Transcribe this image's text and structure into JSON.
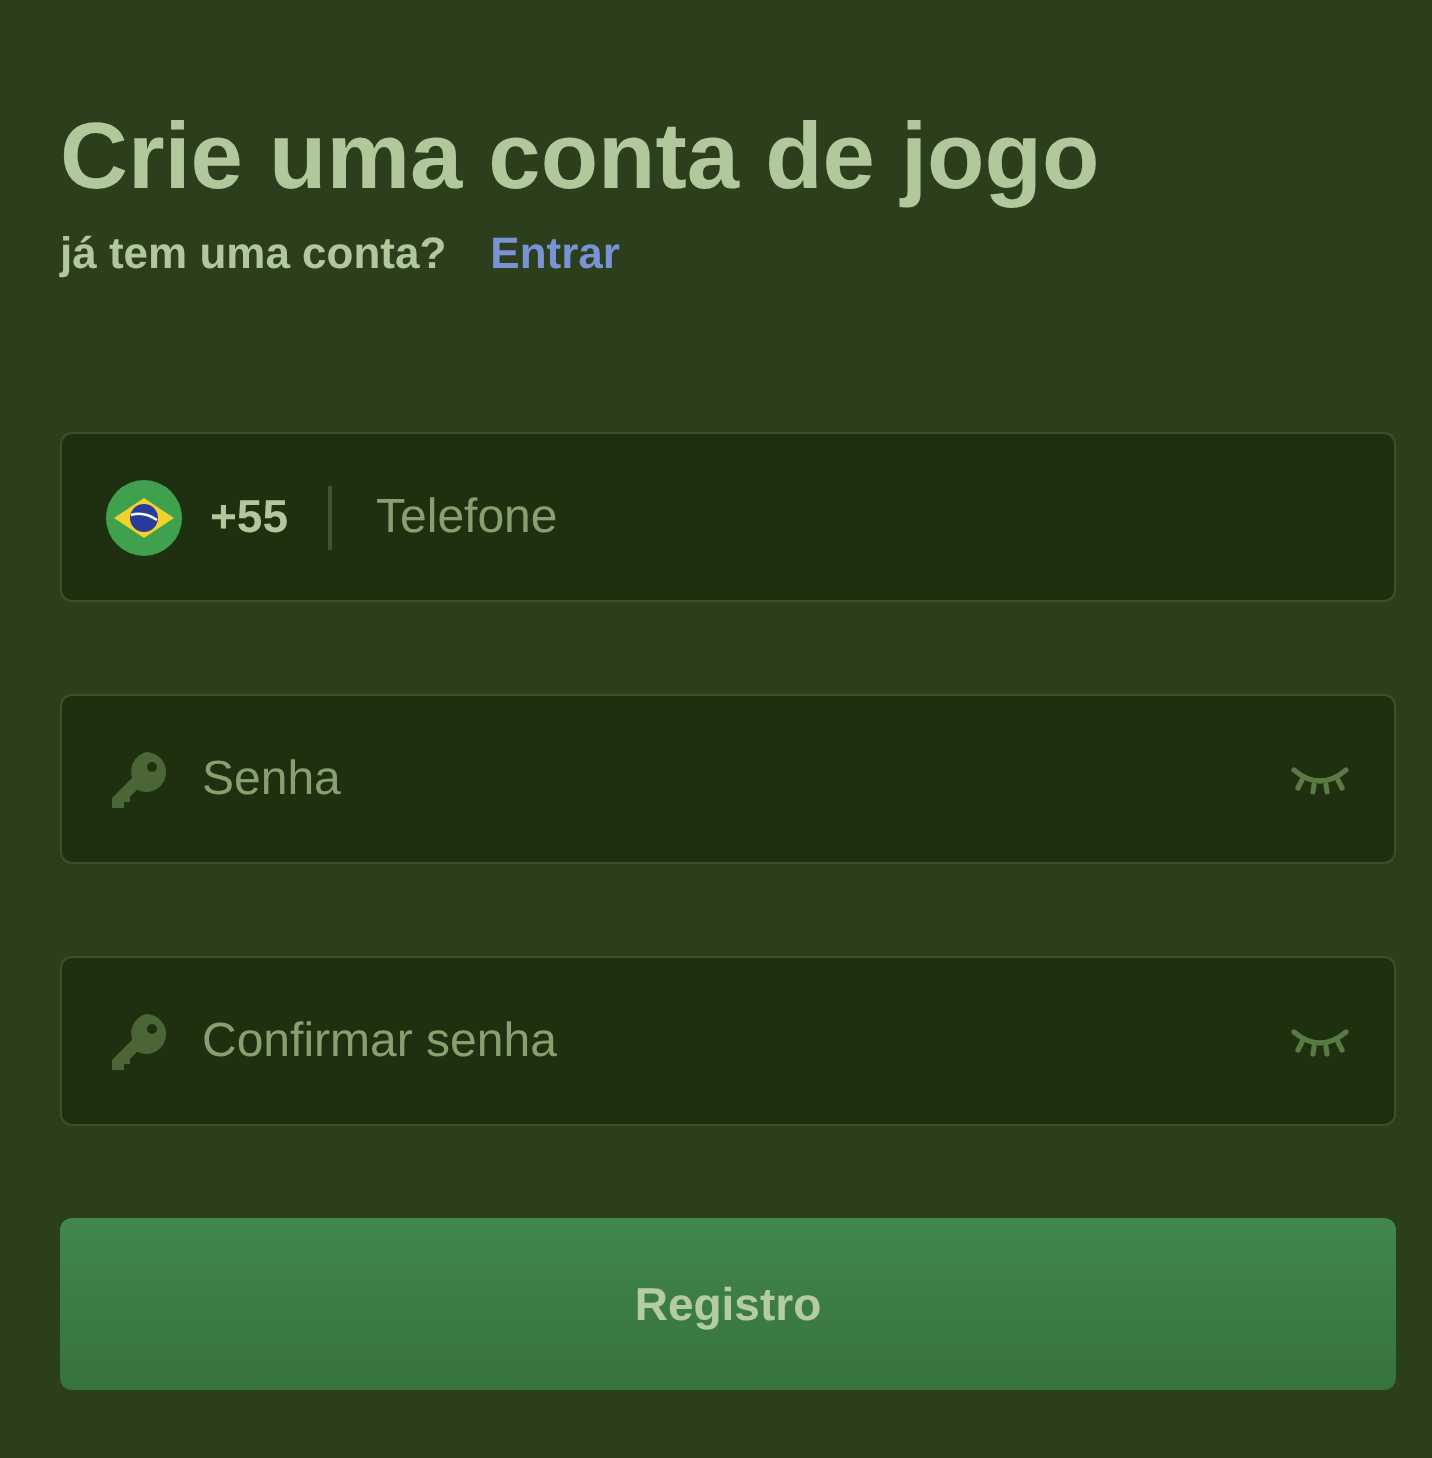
{
  "title": "Crie uma conta de jogo",
  "login_prompt": {
    "text": "já tem uma conta?",
    "link": "Entrar"
  },
  "fields": [
    {
      "kind": "phone",
      "country_code": "+55",
      "placeholder": "Telefone"
    },
    {
      "kind": "password",
      "placeholder": "Senha"
    },
    {
      "kind": "password",
      "placeholder": "Confirmar senha"
    }
  ],
  "submit_button": {
    "label": "Registro",
    "disabled": true
  }
}
